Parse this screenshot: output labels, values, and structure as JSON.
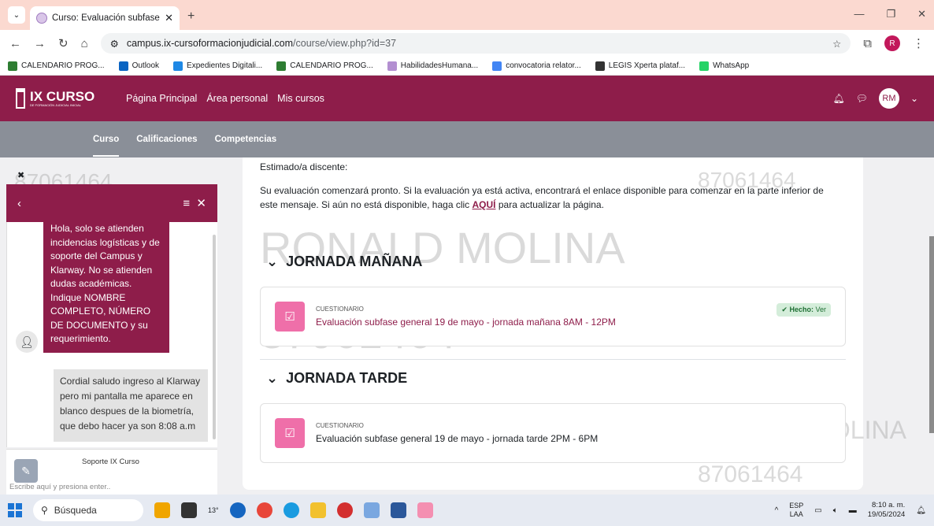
{
  "browser": {
    "tab_title": "Curso: Evaluación subfase gene",
    "url_host": "campus.ix-cursoformacionjudicial.com",
    "url_path": "/course/view.php?id=37",
    "profile_initial": "R",
    "bookmarks": [
      {
        "label": "CALENDARIO PROG...",
        "color": "#2e7d32"
      },
      {
        "label": "Outlook",
        "color": "#0a64c2"
      },
      {
        "label": "Expedientes Digitali...",
        "color": "#1e88e5"
      },
      {
        "label": "CALENDARIO PROG...",
        "color": "#2e7d32"
      },
      {
        "label": "HabilidadesHumana...",
        "color": "#b38fd1"
      },
      {
        "label": "convocatoria relator...",
        "color": "#4285f4"
      },
      {
        "label": "LEGIS Xperta plataf...",
        "color": "#333333"
      },
      {
        "label": "WhatsApp",
        "color": "#25d366"
      }
    ]
  },
  "header": {
    "logo_title": "IX CURSO",
    "logo_sub": "DE FORMACIÓN JUDICIAL INICIAL",
    "nav": [
      "Página Principal",
      "Área personal",
      "Mis cursos"
    ],
    "avatar": "RM"
  },
  "subnav": {
    "tabs": [
      "Curso",
      "Calificaciones",
      "Competencias"
    ]
  },
  "content": {
    "greeting": "Estimado/a discente:",
    "message_pre": "Su evaluación comenzará pronto. Si la evaluación ya está activa, encontrará el enlace disponible para comenzar en la parte inferior de este mensaje. Si aún no está disponible, haga clic ",
    "message_link": "AQUÍ",
    "message_post": " para actualizar la página.",
    "sections": [
      {
        "title": "JORNADA MAÑANA",
        "activity_type": "CUESTIONARIO",
        "activity_name": "Evaluación subfase general 19 de mayo - jornada mañana 8AM - 12PM",
        "completion": "Hecho:",
        "completion_link": "Ver"
      },
      {
        "title": "JORNADA TARDE",
        "activity_type": "CUESTIONARIO",
        "activity_name": "Evaluación subfase general 19 de mayo - jornada tarde 2PM - 6PM"
      }
    ],
    "watermark_name": "RONALD MOLINA",
    "watermark_id": "87061464"
  },
  "chat": {
    "bot_message": "Hola, solo se atienden incidencias logísticas y de soporte del Campus y Klarway. No se atienden dudas académicas. Indique NOMBRE COMPLETO, NÚMERO DE DOCUMENTO y su requerimiento.",
    "user_message": "Cordial saludo ingreso al Klarway pero mi pantalla me aparece en blanco despues de la biometría, que debo hacer ya son 8:08 a.m",
    "agent_name": "Soporte IX Curso",
    "input_placeholder": "Escribe aquí y presiona enter..",
    "watermark_id": "87061464"
  },
  "taskbar": {
    "search": "Búsqueda",
    "weather": "13°",
    "lang_1": "ESP",
    "lang_2": "LAA",
    "time": "8:10 a. m.",
    "date": "19/05/2024"
  }
}
